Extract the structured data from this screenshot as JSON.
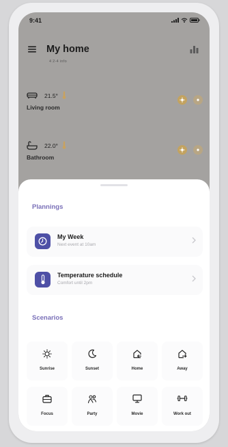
{
  "status_bar": {
    "time": "9:41"
  },
  "header": {
    "title": "My home",
    "subtitle": "4 2-4 info"
  },
  "rooms": [
    {
      "temperature": "21.5°",
      "name": "Living room"
    },
    {
      "temperature": "22.0°",
      "name": "Bathroom"
    }
  ],
  "plannings": {
    "title": "Plannings",
    "items": [
      {
        "title": "My Week",
        "subtitle": "Next event at 10am",
        "icon": "clock-icon"
      },
      {
        "title": "Temperature schedule",
        "subtitle": "Comfort until 2pm",
        "icon": "thermometer-icon"
      }
    ]
  },
  "scenarios": {
    "title": "Scenarios",
    "items": [
      {
        "label": "Sunrise",
        "icon": "sun-icon"
      },
      {
        "label": "Sunset",
        "icon": "moon-icon"
      },
      {
        "label": "Home",
        "icon": "home-in-icon"
      },
      {
        "label": "Away",
        "icon": "home-out-icon"
      },
      {
        "label": "Focus",
        "icon": "briefcase-icon"
      },
      {
        "label": "Party",
        "icon": "people-icon"
      },
      {
        "label": "Movie",
        "icon": "monitor-icon"
      },
      {
        "label": "Work out",
        "icon": "dumbbell-icon"
      }
    ]
  },
  "colors": {
    "accent": "#7a70b8",
    "plan_icon_bg": "#4e50a6",
    "backdrop": "#a4a2a0"
  }
}
